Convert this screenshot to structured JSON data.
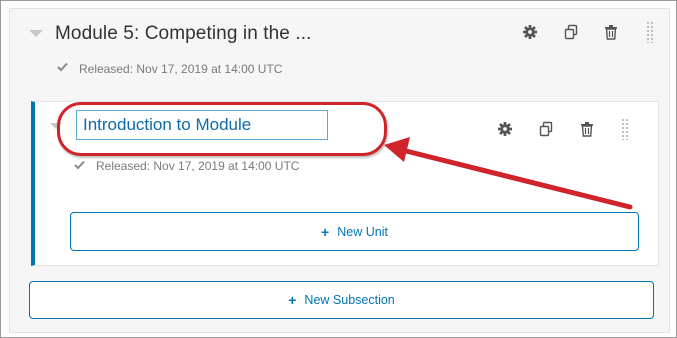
{
  "section": {
    "title": "Module 5: Competing in the ...",
    "release_text": "Released: Nov 17, 2019 at 14:00 UTC"
  },
  "subsection": {
    "name_value": "Introduction to Module",
    "release_text": "Released: Nov 17, 2019 at 14:00 UTC",
    "new_unit_label": "New Unit"
  },
  "new_subsection_label": "New Subsection",
  "icons": {
    "settings": "gear-icon",
    "duplicate": "duplicate-icon",
    "delete": "trash-icon",
    "drag": "drag-handle-icon",
    "expand": "caret-down-icon",
    "released": "checkmark-icon",
    "add": "plus-icon"
  },
  "colors": {
    "accent": "#0075b4",
    "annotation": "#d0242b"
  }
}
